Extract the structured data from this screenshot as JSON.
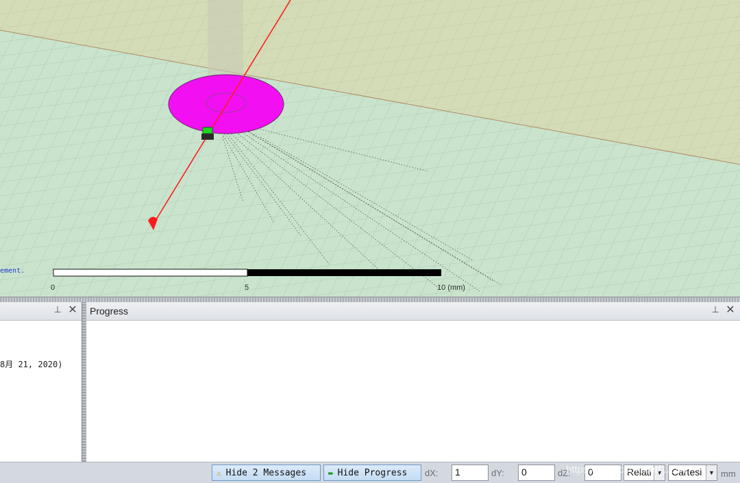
{
  "viewport": {
    "status_text": "ement.",
    "ruler": {
      "labels": [
        "0",
        "5",
        "10 (mm)"
      ]
    },
    "colors": {
      "ground_plane": "#c9e3cd",
      "back_plane": "#d3dcb7",
      "disc": "#f20ff2",
      "axis": "#ff1a1a",
      "grid": "#a9c9ae"
    }
  },
  "left_panel": {
    "message": "8月 21, 2020)",
    "pin_icon": "pin-icon",
    "close_icon": "close-icon",
    "pin_glyph": "⊥",
    "close_glyph": "✕"
  },
  "right_panel": {
    "title": "Progress",
    "pin_glyph": "⊥",
    "close_glyph": "✕"
  },
  "statusbar": {
    "hide_messages_label": "Hide 2 Messages",
    "hide_progress_label": "Hide Progress",
    "warning_icon": "warning-icon",
    "progress_icon": "progress-icon",
    "dx_label": "dX:",
    "dx_value": "1",
    "dy_label": "dY:",
    "dy_value": "0",
    "dz_label": "dZ:",
    "dz_value": "0",
    "mode_select": "Relati",
    "coord_select": "Cartesi",
    "unit": "mm",
    "watermark": "https://blog.csdn.net/...2847"
  }
}
